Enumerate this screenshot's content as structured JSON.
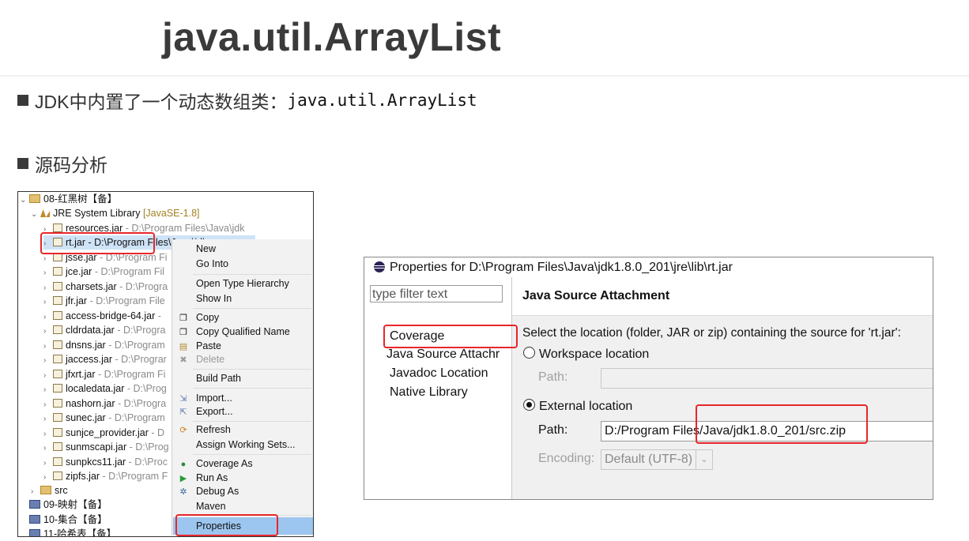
{
  "slide": {
    "title": "java.util.ArrayList",
    "bullet1_prefix": "JDK中内置了一个动态数组类：",
    "bullet1_code": "java.util.ArrayList",
    "bullet2": "源码分析"
  },
  "tree": {
    "project": "08-红黑树【备】",
    "jre_label": "JRE System Library",
    "jre_version": "[JavaSE-1.8]",
    "jars": [
      {
        "name": "resources.jar",
        "path": " - D:\\Program Files\\Java\\jdk"
      },
      {
        "name": "rt.jar",
        "path": " - D:\\Program Files\\Java\\jdk"
      },
      {
        "name": "jsse.jar",
        "path": " - D:\\Program Fi"
      },
      {
        "name": "jce.jar",
        "path": " - D:\\Program Fil"
      },
      {
        "name": "charsets.jar",
        "path": " - D:\\Progra"
      },
      {
        "name": "jfr.jar",
        "path": " - D:\\Program File"
      },
      {
        "name": "access-bridge-64.jar",
        "path": " -"
      },
      {
        "name": "cldrdata.jar",
        "path": " - D:\\Progra"
      },
      {
        "name": "dnsns.jar",
        "path": " - D:\\Program"
      },
      {
        "name": "jaccess.jar",
        "path": " - D:\\Prograr"
      },
      {
        "name": "jfxrt.jar",
        "path": " - D:\\Program Fi"
      },
      {
        "name": "localedata.jar",
        "path": " - D:\\Prog"
      },
      {
        "name": "nashorn.jar",
        "path": " - D:\\Progra"
      },
      {
        "name": "sunec.jar",
        "path": " - D:\\Program"
      },
      {
        "name": "sunjce_provider.jar",
        "path": " - D"
      },
      {
        "name": "sunmscapi.jar",
        "path": " - D:\\Prog"
      },
      {
        "name": "sunpkcs11.jar",
        "path": " - D:\\Proc"
      },
      {
        "name": "zipfs.jar",
        "path": " - D:\\Program F"
      }
    ],
    "src": "src",
    "p09": "09-映射【备】",
    "p10": "10-集合【备】",
    "p11": "11-哈希表【备】"
  },
  "menu": {
    "items": [
      "New",
      "Go Into",
      "Open Type Hierarchy",
      "Show In",
      "Copy",
      "Copy Qualified Name",
      "Paste",
      "Delete",
      "Build Path",
      "Import...",
      "Export...",
      "Refresh",
      "Assign Working Sets...",
      "Coverage As",
      "Run As",
      "Debug As",
      "Maven",
      "Properties"
    ]
  },
  "dialog": {
    "title": "Properties for D:\\Program Files\\Java\\jdk1.8.0_201\\jre\\lib\\rt.jar",
    "filter_placeholder": "type filter text",
    "nav": [
      "Coverage",
      "Java Source Attachr",
      "Javadoc Location",
      "Native Library"
    ],
    "heading": "Java Source Attachment",
    "description": "Select the location (folder, JAR or zip) containing the source for 'rt.jar':",
    "workspace_option": "Workspace location",
    "workspace_path_label": "Path:",
    "external_option": "External location",
    "external_path_label": "Path:",
    "external_path_value": "D:/Program Files/Java/jdk1.8.0_201/src.zip",
    "encoding_label": "Encoding:",
    "encoding_value": "Default (UTF-8)"
  }
}
